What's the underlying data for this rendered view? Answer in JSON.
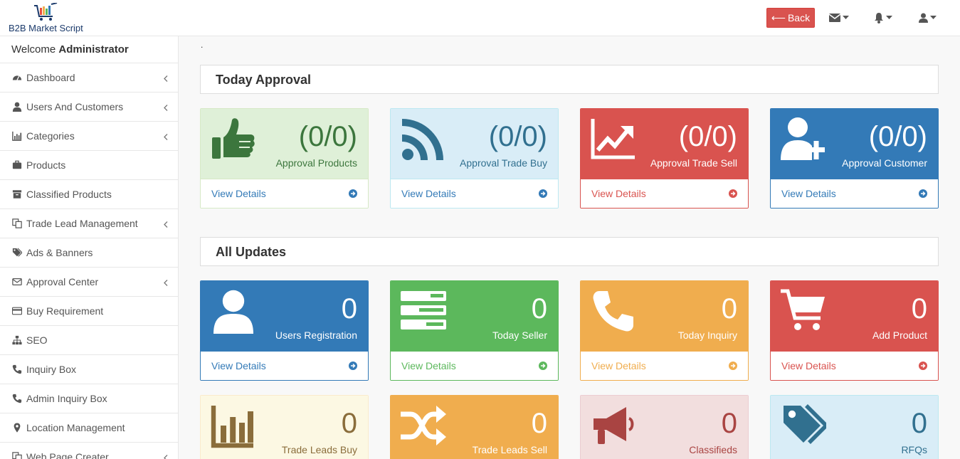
{
  "header": {
    "logo_text": "B2B Market Script",
    "back_label": "Back",
    "icons": [
      "envelope-icon",
      "bell-icon",
      "user-icon"
    ]
  },
  "sidebar": {
    "welcome_prefix": "Welcome",
    "welcome_user": "Administrator",
    "items": [
      {
        "label": "Dashboard",
        "icon": "dashboard-icon",
        "has_submenu": true
      },
      {
        "label": "Users And Customers",
        "icon": "user-icon",
        "has_submenu": true
      },
      {
        "label": "Categories",
        "icon": "bar-chart-icon",
        "has_submenu": true
      },
      {
        "label": "Products",
        "icon": "briefcase-icon",
        "has_submenu": false
      },
      {
        "label": "Classified Products",
        "icon": "archive-icon",
        "has_submenu": false
      },
      {
        "label": "Trade Lead Management",
        "icon": "copy-icon",
        "has_submenu": true
      },
      {
        "label": "Ads & Banners",
        "icon": "tags-icon",
        "has_submenu": false
      },
      {
        "label": "Approval Center",
        "icon": "envelope-icon",
        "has_submenu": true
      },
      {
        "label": "Buy Requirement",
        "icon": "credit-card-icon",
        "has_submenu": false
      },
      {
        "label": "SEO",
        "icon": "sitemap-icon",
        "has_submenu": false
      },
      {
        "label": "Inquiry Box",
        "icon": "phone-icon",
        "has_submenu": false
      },
      {
        "label": "Admin Inquiry Box",
        "icon": "phone-icon",
        "has_submenu": false
      },
      {
        "label": "Location Management",
        "icon": "map-marker-icon",
        "has_submenu": false
      },
      {
        "label": "Web Page Creater",
        "icon": "copy-icon",
        "has_submenu": true
      }
    ]
  },
  "main": {
    "dot": ".",
    "today_approval_title": "Today Approval",
    "all_updates_title": "All Updates",
    "today_cards": [
      {
        "count": "(0/0)",
        "label": "Approval Products",
        "link": "View Details",
        "icon": "thumbs-up-icon",
        "head_bg": "#dff0d8",
        "border": "#d6e9c6",
        "fg": "#3c763d",
        "link_color": "#337ab7"
      },
      {
        "count": "(0/0)",
        "label": "Approval Trade Buy",
        "link": "View Details",
        "icon": "rss-icon",
        "head_bg": "#d9edf7",
        "border": "#bce8f1",
        "fg": "#31708f",
        "link_color": "#337ab7"
      },
      {
        "count": "(0/0)",
        "label": "Approval Trade Sell",
        "link": "View Details",
        "icon": "line-chart-icon",
        "head_bg": "#d9534f",
        "border": "#d9534f",
        "fg": "#ffffff",
        "link_color": "#d9534f"
      },
      {
        "count": "(0/0)",
        "label": "Approval Customer",
        "link": "View Details",
        "icon": "user-plus-icon",
        "head_bg": "#337ab7",
        "border": "#337ab7",
        "fg": "#ffffff",
        "link_color": "#337ab7"
      }
    ],
    "update_cards": [
      {
        "count": "0",
        "label": "Users Registration",
        "link": "View Details",
        "icon": "user-icon",
        "head_bg": "#337ab7",
        "border": "#337ab7",
        "fg": "#ffffff",
        "link_color": "#337ab7"
      },
      {
        "count": "0",
        "label": "Today Seller",
        "link": "View Details",
        "icon": "tasks-icon",
        "head_bg": "#5cb85c",
        "border": "#5cb85c",
        "fg": "#ffffff",
        "link_color": "#5cb85c"
      },
      {
        "count": "0",
        "label": "Today Inquiry",
        "link": "View Details",
        "icon": "phone-icon",
        "head_bg": "#f0ad4e",
        "border": "#f0ad4e",
        "fg": "#ffffff",
        "link_color": "#f0ad4e"
      },
      {
        "count": "0",
        "label": "Add Product",
        "link": "View Details",
        "icon": "shopping-cart-icon",
        "head_bg": "#d9534f",
        "border": "#d9534f",
        "fg": "#ffffff",
        "link_color": "#d9534f"
      }
    ],
    "more_cards": [
      {
        "count": "0",
        "label": "Trade Leads Buy",
        "icon": "bar-chart-icon",
        "head_bg": "#fcf8e3",
        "border": "#faebcc",
        "fg": "#8a6d3b"
      },
      {
        "count": "0",
        "label": "Trade Leads Sell",
        "icon": "random-icon",
        "head_bg": "#f0ad4e",
        "border": "#f0ad4e",
        "fg": "#ffffff"
      },
      {
        "count": "0",
        "label": "Classifieds",
        "icon": "bullhorn-icon",
        "head_bg": "#f2dede",
        "border": "#ebccd1",
        "fg": "#a94442"
      },
      {
        "count": "0",
        "label": "RFQs",
        "icon": "tags-icon",
        "head_bg": "#d9edf7",
        "border": "#bce8f1",
        "fg": "#31708f"
      }
    ]
  }
}
